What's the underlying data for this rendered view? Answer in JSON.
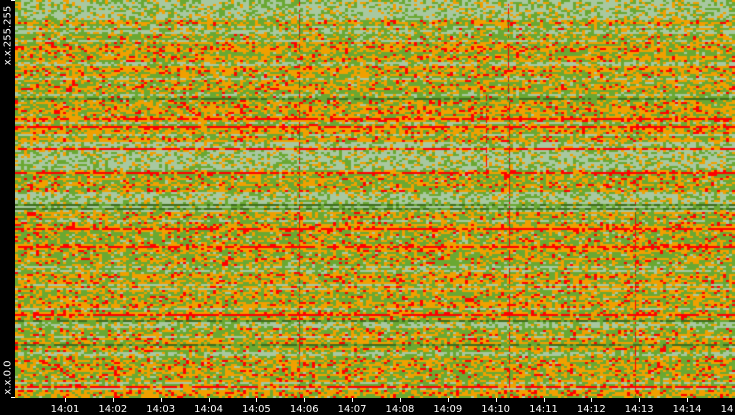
{
  "chart_data": {
    "type": "heatmap",
    "title": "",
    "xlabel": "",
    "ylabel": "",
    "x_tick_labels": [
      "14:01",
      "14:02",
      "14:03",
      "14:04",
      "14:05",
      "14:06",
      "14:07",
      "14:08",
      "14:09",
      "14:10",
      "14:11",
      "14:12",
      "14:13",
      "14:14",
      "14"
    ],
    "y_tick_labels": [
      "x.x.255.255",
      "x.x.0.0"
    ],
    "y_range": [
      "x.x.0.0",
      "x.x.255.255"
    ],
    "x_range": [
      "14:00",
      "14:15"
    ],
    "colorscale": [
      "#a8c8a0",
      "#6aa832",
      "#3e6e1e",
      "#f0a000",
      "#ff0000"
    ],
    "notable_events": [
      "14:06",
      "14:10",
      "14:13"
    ]
  }
}
